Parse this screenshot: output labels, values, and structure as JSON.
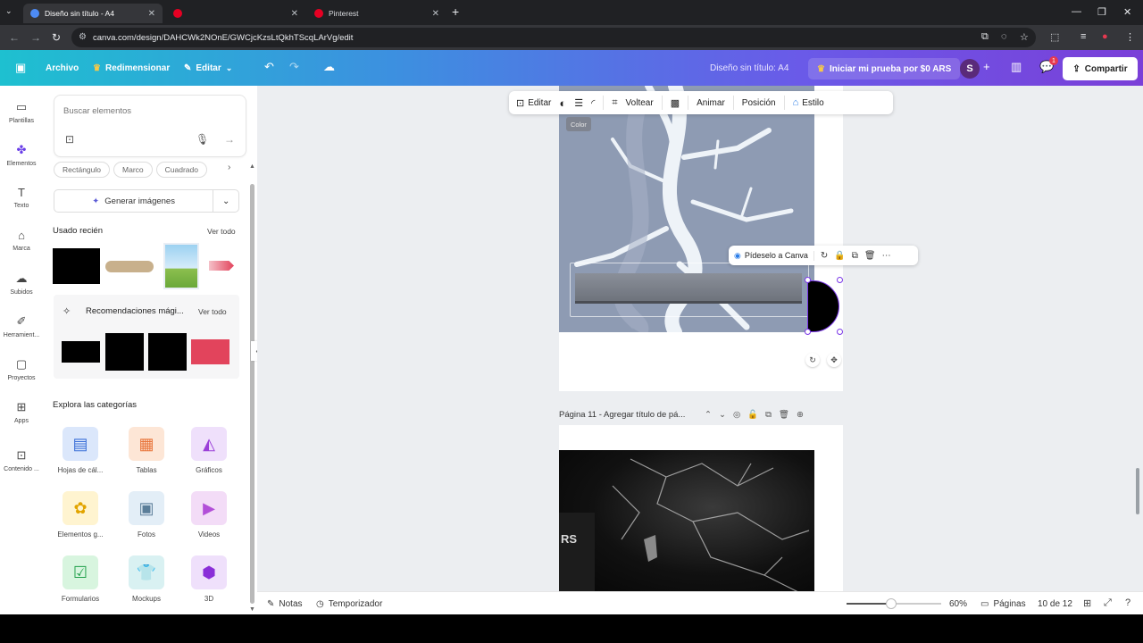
{
  "browser": {
    "tabs": [
      {
        "title": "Diseño sin título - A4",
        "active": true
      },
      {
        "title": "",
        "active": false
      },
      {
        "title": "Pinterest",
        "active": false
      }
    ],
    "url": "canva.com/design/DAHCWk2NOnE/GWCjcKzsLtQkhTScqLArVg/edit"
  },
  "topbar": {
    "archivo": "Archivo",
    "redimensionar": "Redimensionar",
    "editar": "Editar",
    "doc_title": "Diseño sin título: A4",
    "trial": "Iniciar mi prueba por $0 ARS",
    "avatar_initial": "S",
    "notif_count": "1",
    "share": "Compartir"
  },
  "rail": [
    {
      "label": "Plantillas",
      "icon": "template-icon"
    },
    {
      "label": "Elementos",
      "icon": "elements-icon"
    },
    {
      "label": "Texto",
      "icon": "text-icon"
    },
    {
      "label": "Marca",
      "icon": "brand-icon"
    },
    {
      "label": "Subidos",
      "icon": "upload-icon"
    },
    {
      "label": "Herramient...",
      "icon": "tools-icon"
    },
    {
      "label": "Proyectos",
      "icon": "folder-icon"
    },
    {
      "label": "Apps",
      "icon": "apps-icon"
    },
    {
      "label": "Contenido ...",
      "icon": "content-icon"
    }
  ],
  "panel": {
    "search_placeholder": "Buscar elementos",
    "chips": [
      "Rectángulo",
      "Marco",
      "Cuadrado"
    ],
    "generate": "Generar imágenes",
    "recent_title": "Usado recién",
    "recent_see_all": "Ver todo",
    "magic_title": "Recomendaciones mági...",
    "magic_see_all": "Ver todo",
    "categories_title": "Explora las categorías",
    "categories": [
      {
        "label": "Hojas de cál...",
        "icon": "spreadsheet-icon"
      },
      {
        "label": "Tablas",
        "icon": "table-icon"
      },
      {
        "label": "Gráficos",
        "icon": "chart-icon"
      },
      {
        "label": "Elementos g...",
        "icon": "sunflower-icon"
      },
      {
        "label": "Fotos",
        "icon": "photo-icon"
      },
      {
        "label": "Videos",
        "icon": "play-icon"
      },
      {
        "label": "Formularios",
        "icon": "form-icon"
      },
      {
        "label": "Mockups",
        "icon": "shirt-icon"
      },
      {
        "label": "3D",
        "icon": "cube-icon"
      }
    ]
  },
  "context_toolbar": {
    "edit": "Editar",
    "flip": "Voltear",
    "animate": "Animar",
    "position": "Posición",
    "style": "Estilo",
    "tooltip": "Color"
  },
  "element_toolbar": {
    "ask": "Pídeselo a Canva"
  },
  "page_header": {
    "title": "Página 11 - Agregar título de pá..."
  },
  "bottombar": {
    "notes": "Notas",
    "timer": "Temporizador",
    "zoom": "60%",
    "zoom_level": 0.47,
    "pages": "Páginas",
    "page_count": "10 de 12"
  }
}
